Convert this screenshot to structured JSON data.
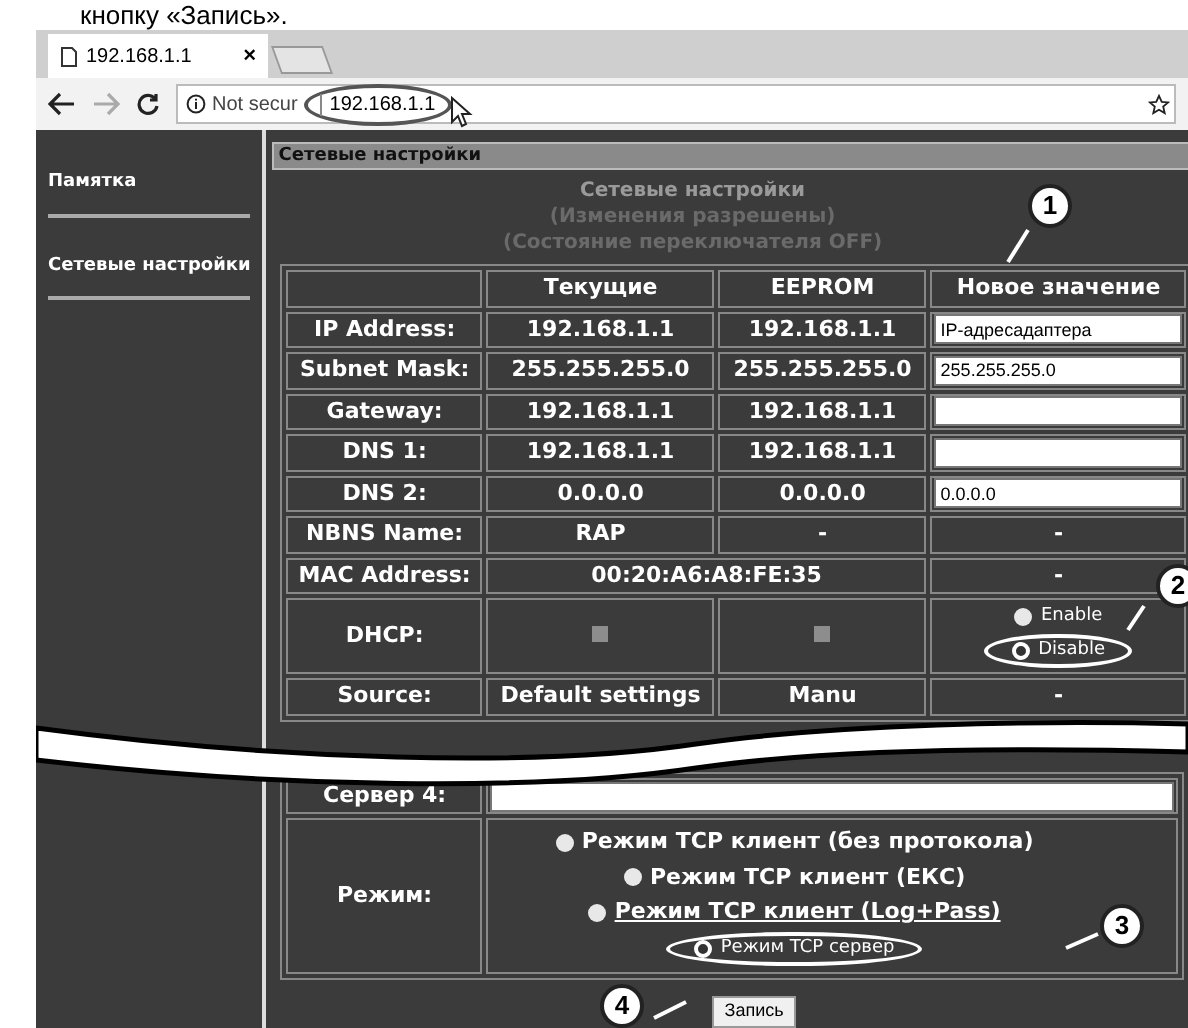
{
  "caption": "кнопку «Запись».",
  "browser": {
    "tab_title": "192.168.1.1",
    "tab_close": "×",
    "security_label": "Not secur",
    "url": "192.168.1.1",
    "url_highlighted": true
  },
  "sidebar": {
    "items": [
      {
        "label": "Памятка"
      },
      {
        "label": "Сетевые настройки"
      }
    ]
  },
  "panel": {
    "title": "Сетевые настройки",
    "heading": [
      "Сетевые настройки",
      "(Изменения разрешены)",
      "(Состояние переключателя OFF)"
    ]
  },
  "table": {
    "columns": [
      "Текущие",
      "EEPROM",
      "Новое значение"
    ],
    "rows": [
      {
        "label": "IP Address:",
        "cells": [
          {
            "kind": "text",
            "text": "192.168.1.1"
          },
          {
            "kind": "text",
            "text": "192.168.1.1"
          },
          {
            "kind": "input",
            "value": "IP-адресадаптера"
          }
        ]
      },
      {
        "label": "Subnet Mask:",
        "cells": [
          {
            "kind": "text",
            "text": "255.255.255.0"
          },
          {
            "kind": "text",
            "text": "255.255.255.0"
          },
          {
            "kind": "input",
            "value": "255.255.255.0"
          }
        ]
      },
      {
        "label": "Gateway:",
        "cells": [
          {
            "kind": "text",
            "text": "192.168.1.1"
          },
          {
            "kind": "text",
            "text": "192.168.1.1"
          },
          {
            "kind": "input"
          }
        ]
      },
      {
        "label": "DNS 1:",
        "cells": [
          {
            "kind": "text",
            "text": "192.168.1.1"
          },
          {
            "kind": "text",
            "text": "192.168.1.1"
          },
          {
            "kind": "input"
          }
        ]
      },
      {
        "label": "DNS 2:",
        "cells": [
          {
            "kind": "text",
            "text": "0.0.0.0"
          },
          {
            "kind": "text",
            "text": "0.0.0.0"
          },
          {
            "kind": "input",
            "value": "0.0.0.0"
          }
        ]
      },
      {
        "label": "NBNS Name:",
        "cells": [
          {
            "kind": "text",
            "text": "RAP"
          },
          {
            "kind": "text",
            "text": "-"
          },
          {
            "kind": "text",
            "text": "-"
          }
        ]
      },
      {
        "label": "MAC Address:",
        "cells": [
          {
            "kind": "merged",
            "text": "00:20:A6:A8:FE:35",
            "colspan": 2
          },
          {
            "kind": "text",
            "text": "-"
          }
        ]
      },
      {
        "label": "DHCP:",
        "cells": [
          {
            "kind": "check",
            "checked": false
          },
          {
            "kind": "check",
            "checked": false
          },
          {
            "kind": "radios",
            "options": [
              {
                "label": "Enable",
                "selected": false,
                "highlighted": false
              },
              {
                "label": "Disable",
                "selected": true,
                "highlighted": true
              }
            ]
          }
        ]
      },
      {
        "label": "Source:",
        "cells": [
          {
            "kind": "text",
            "text": "Default settings"
          },
          {
            "kind": "text",
            "text": "Manu"
          },
          {
            "kind": "text",
            "text": "-"
          }
        ]
      }
    ]
  },
  "lower_rows": [
    {
      "label": "Сервер 4:",
      "cell": {
        "kind": "input"
      }
    },
    {
      "label": "Режим:",
      "cell": {
        "kind": "radios",
        "options": [
          {
            "label": "Режим TCP клиент (без протокола)",
            "selected": false,
            "highlighted": false,
            "underlined": false
          },
          {
            "label": "Режим TCP клиент (ЕКС)",
            "selected": false,
            "highlighted": false,
            "underlined": false
          },
          {
            "label": "Режим TCP клиент (Log+Pass)",
            "selected": false,
            "highlighted": false,
            "underlined": true
          },
          {
            "label": "Режим TCP сервер",
            "selected": true,
            "highlighted": true,
            "underlined": false
          }
        ]
      }
    }
  ],
  "save_button": "Запись",
  "callouts": [
    {
      "number": "1"
    },
    {
      "number": "2"
    },
    {
      "number": "3"
    },
    {
      "number": "4"
    }
  ]
}
